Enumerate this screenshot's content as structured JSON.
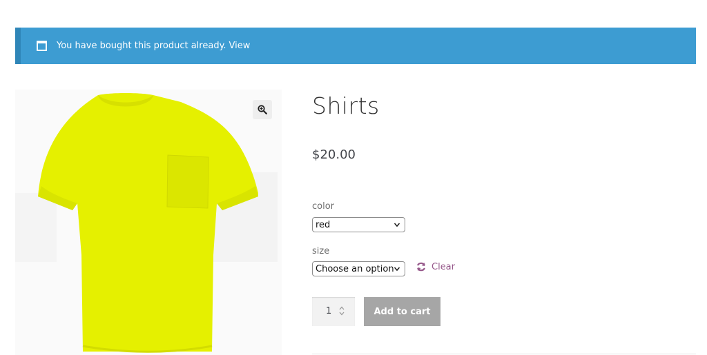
{
  "notice": {
    "icon": "browser-window-icon",
    "message": "You have bought this product already.",
    "link_label": "View",
    "bg_color": "#3d9cd2"
  },
  "product": {
    "title": "Shirts",
    "price": "$20.00",
    "image_icon": "yellow-tshirt-image",
    "shirt_color": "#e5f000"
  },
  "gallery": {
    "zoom_icon": "magnifier-plus-icon"
  },
  "variations": {
    "color": {
      "label": "color",
      "selected": "red"
    },
    "size": {
      "label": "size",
      "selected": "Choose an option"
    },
    "clear_label": "Clear",
    "clear_icon": "refresh-icon",
    "link_color": "#96588a"
  },
  "cart": {
    "quantity": "1",
    "add_label": "Add to cart",
    "button_color": "#a6a6a6"
  }
}
